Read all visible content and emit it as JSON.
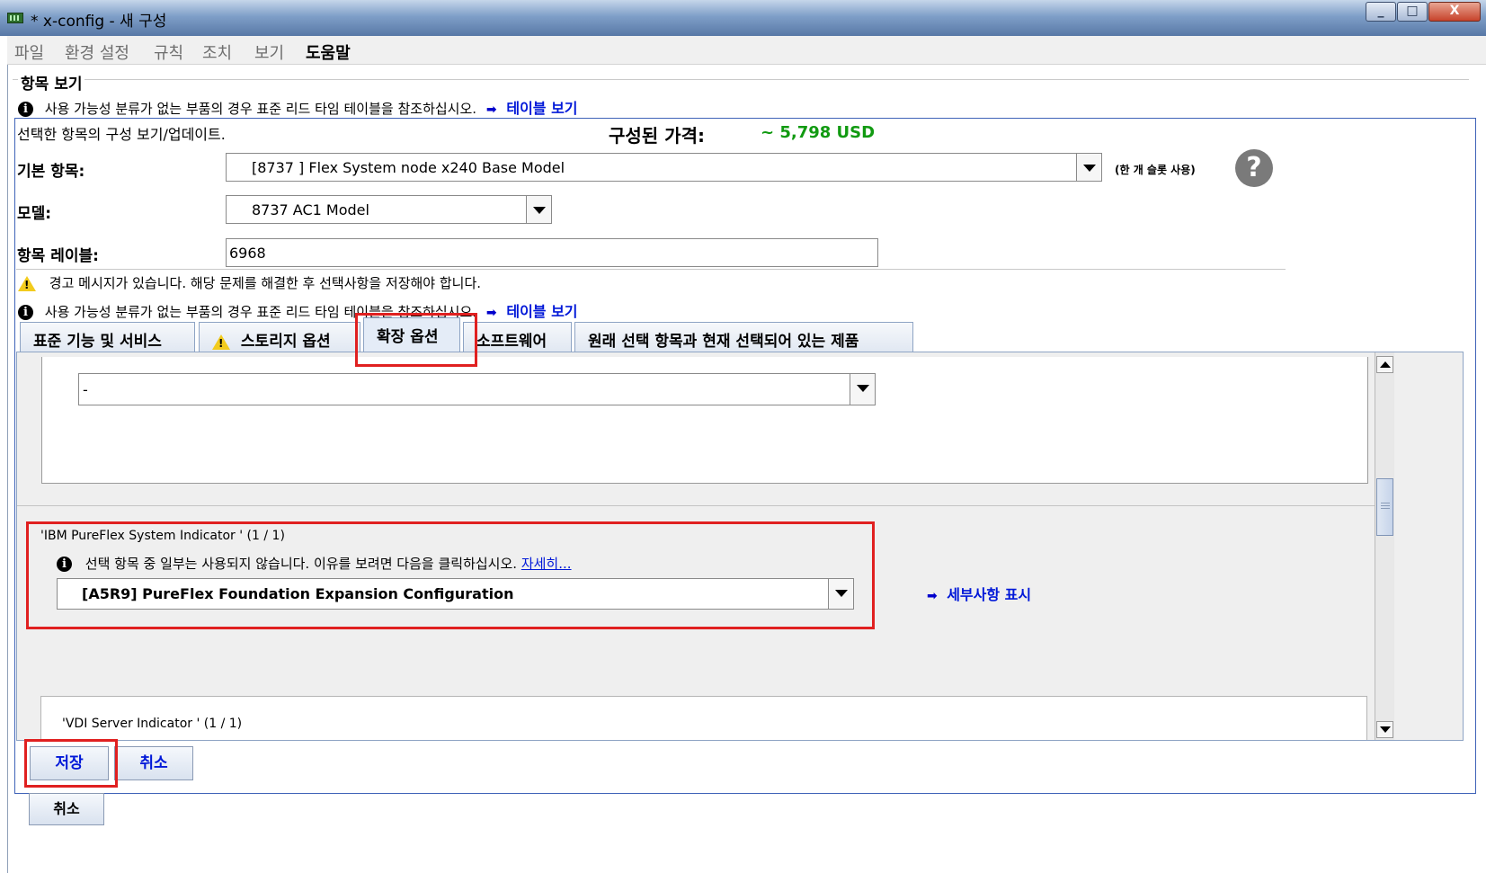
{
  "window": {
    "title": "* x-config - 새 구성",
    "min": "_",
    "max": "□",
    "close": "X"
  },
  "menu": [
    "파일",
    "환경 설정",
    "규칙",
    "조치",
    "보기",
    "도움말"
  ],
  "section": {
    "title": "항목 보기"
  },
  "top_notice": {
    "text": "사용 가능성 분류가 없는 부품의 경우 표준 리드 타임 테이블을 참조하십시오.",
    "link": "테이블 보기"
  },
  "config": {
    "view_update_label": "선택한 항목의 구성 보기/업데이트.",
    "price_label": "구성된 가격:",
    "price_value": "~ 5,798 USD",
    "base_item_label": "기본 항목:",
    "base_item_value": "[8737 ] Flex System node x240  Base Model",
    "slot_note": "(한 개 슬롯 사용)",
    "help": "?",
    "model_label": "모델:",
    "model_value": "8737 AC1 Model",
    "item_label_label": "항목 레이블:",
    "item_label_value": "6968"
  },
  "warnings": {
    "warning_text": "경고 메시지가 있습니다. 해당 문제를 해결한 후 선택사항을 저장해야 합니다.",
    "info_text": "사용 가능성 분류가 없는 부품의 경우 표준 리드 타임 테이블을 참조하십시오.",
    "info_link": "테이블 보기"
  },
  "tabs": [
    {
      "label": "표준 기능 및 서비스"
    },
    {
      "label": "스토리지 옵션"
    },
    {
      "label": "확장 옵션"
    },
    {
      "label": "소프트웨어"
    },
    {
      "label": "원래 선택 항목과 현재 선택되어 있는 제품"
    }
  ],
  "expansion": {
    "first_select_value": "-",
    "pureflex": {
      "title": "'IBM PureFlex System Indicator ' (1 / 1)",
      "notice": "선택 항목 중 일부는 사용되지 않습니다. 이유를 보려면 다음을 클릭하십시오.",
      "notice_link": "자세히...",
      "select_value": "[A5R9] PureFlex Foundation Expansion Configuration",
      "details_link": "세부사항 표시"
    },
    "vdi": {
      "title": "'VDI Server Indicator ' (1 / 1)"
    }
  },
  "buttons": {
    "save": "저장",
    "cancel": "취소",
    "cancel_outer": "취소"
  },
  "colors": {
    "price": "#119a11",
    "link": "#0018d8",
    "highlight": "#e02020"
  }
}
